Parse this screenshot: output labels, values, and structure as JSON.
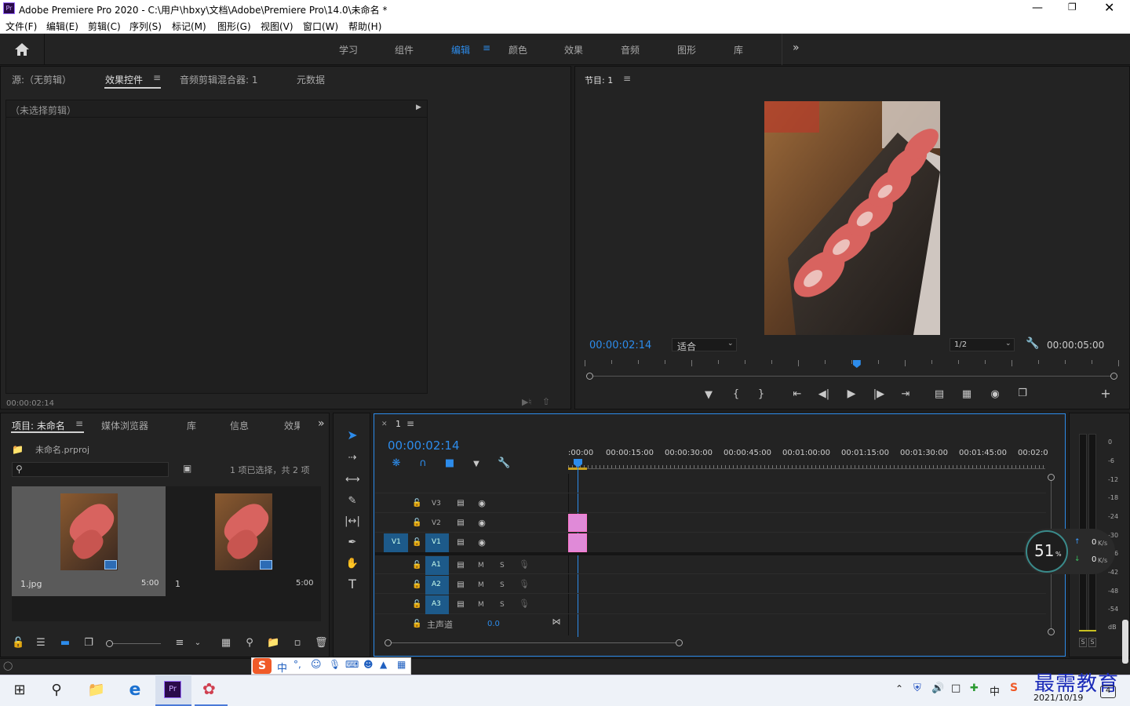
{
  "window": {
    "title": "Adobe Premiere Pro 2020 - C:\\用户\\hbxy\\文档\\Adobe\\Premiere Pro\\14.0\\未命名 *",
    "app_icon": "Pr"
  },
  "menu": [
    "文件(F)",
    "编辑(E)",
    "剪辑(C)",
    "序列(S)",
    "标记(M)",
    "图形(G)",
    "视图(V)",
    "窗口(W)",
    "帮助(H)"
  ],
  "workspaces": {
    "tabs": [
      "学习",
      "组件",
      "编辑",
      "颜色",
      "效果",
      "音频",
      "图形",
      "库"
    ],
    "active": "编辑"
  },
  "source_panel": {
    "tabs": [
      "源:（无剪辑）",
      "效果控件",
      "音频剪辑混合器: 1",
      "元数据"
    ],
    "active_tab": "效果控件",
    "no_clip": "（未选择剪辑）",
    "timecode": "00:00:02:14"
  },
  "program_monitor": {
    "title": "节目: 1",
    "timecode": "00:00:02:14",
    "fit": "适合",
    "resolution": "1/2",
    "duration": "00:00:05:00",
    "playhead_fraction": 0.51
  },
  "project_panel": {
    "tabs": [
      "项目: 未命名",
      "媒体浏览器",
      "库",
      "信息",
      "效果"
    ],
    "project_file": "未命名.prproj",
    "search_placeholder": "",
    "selection_info": "1 项已选择，共 2 项",
    "items": [
      {
        "name": "1.jpg",
        "duration": "5:00"
      },
      {
        "name": "1",
        "duration": "5:00"
      }
    ]
  },
  "timeline": {
    "tab": "1",
    "timecode": "00:00:02:14",
    "ruler": [
      ":00:00",
      "00:00:15:00",
      "00:00:30:00",
      "00:00:45:00",
      "00:01:00:00",
      "00:01:15:00",
      "00:01:30:00",
      "00:01:45:00",
      "00:02:0"
    ],
    "video_tracks": [
      "V3",
      "V2",
      "V1"
    ],
    "source_patch": "V1",
    "audio_tracks": [
      "A1",
      "A2",
      "A3"
    ],
    "mute_label": "M",
    "solo_label": "S",
    "master_label": "主声道",
    "master_value": "0.0"
  },
  "audio_meter": {
    "scale": [
      "0",
      "-6",
      "-12",
      "-18",
      "-24",
      "-30",
      "-36",
      "-42",
      "-48",
      "-54",
      "dB"
    ],
    "solo": [
      "S",
      "S"
    ]
  },
  "net_widget": {
    "percent": "51",
    "unit": "%",
    "up": "0",
    "down": "0",
    "rate_unit": "K/s"
  },
  "ime_toolbar": {
    "label": "中"
  },
  "taskbar": {
    "tray_lang": "中",
    "date": "2021/10/19",
    "notification_count": "4"
  },
  "watermark": "最需教育",
  "colors": {
    "accent_blue": "#2d8ceb",
    "clip_pink": "#e08ad8",
    "panel_bg": "#232323"
  }
}
